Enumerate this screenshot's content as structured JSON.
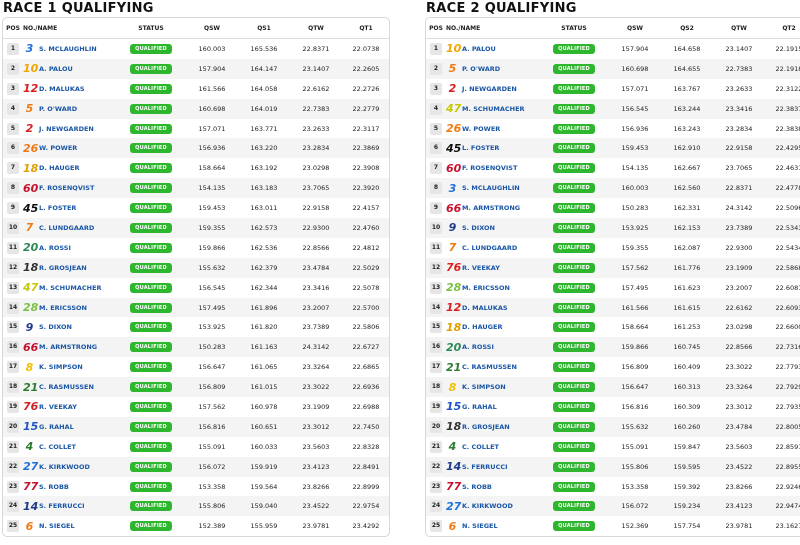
{
  "race1": {
    "title": "RACE 1 QUALIFYING",
    "headers": [
      "POS",
      "NO./NAME",
      "STATUS",
      "QSW",
      "QS1",
      "QTW",
      "QT1"
    ],
    "rows": [
      {
        "pos": "1",
        "num": "3",
        "color": "#1e6fd9",
        "name": "S. MCLAUGHLIN",
        "status": "QUALIFIED",
        "qsw": "160.003",
        "qs": "165.536",
        "qtw": "22.8371",
        "qt": "22.0738"
      },
      {
        "pos": "2",
        "num": "10",
        "color": "#f0a500",
        "name": "A. PALOU",
        "status": "QUALIFIED",
        "qsw": "157.904",
        "qs": "164.147",
        "qtw": "23.1407",
        "qt": "22.2605"
      },
      {
        "pos": "3",
        "num": "12",
        "color": "#d81e1e",
        "name": "D. MALUKAS",
        "status": "QUALIFIED",
        "qsw": "161.566",
        "qs": "164.058",
        "qtw": "22.6162",
        "qt": "22.2726"
      },
      {
        "pos": "4",
        "num": "5",
        "color": "#f07a10",
        "name": "P. O'WARD",
        "status": "QUALIFIED",
        "qsw": "160.698",
        "qs": "164.019",
        "qtw": "22.7383",
        "qt": "22.2779"
      },
      {
        "pos": "5",
        "num": "2",
        "color": "#d81e1e",
        "name": "J. NEWGARDEN",
        "status": "QUALIFIED",
        "qsw": "157.071",
        "qs": "163.771",
        "qtw": "23.2633",
        "qt": "22.3117"
      },
      {
        "pos": "6",
        "num": "26",
        "color": "#f07a10",
        "name": "W. POWER",
        "status": "QUALIFIED",
        "qsw": "156.936",
        "qs": "163.220",
        "qtw": "23.2834",
        "qt": "22.3869"
      },
      {
        "pos": "7",
        "num": "18",
        "color": "#e0a000",
        "name": "D. HAUGER",
        "status": "QUALIFIED",
        "qsw": "158.664",
        "qs": "163.192",
        "qtw": "23.0298",
        "qt": "22.3908"
      },
      {
        "pos": "8",
        "num": "60",
        "color": "#c8102e",
        "name": "F. ROSENQVIST",
        "status": "QUALIFIED",
        "qsw": "154.135",
        "qs": "163.183",
        "qtw": "23.7065",
        "qt": "22.3920"
      },
      {
        "pos": "9",
        "num": "45",
        "color": "#111111",
        "name": "L. FOSTER",
        "status": "QUALIFIED",
        "qsw": "159.453",
        "qs": "163.011",
        "qtw": "22.9158",
        "qt": "22.4157"
      },
      {
        "pos": "10",
        "num": "7",
        "color": "#f07a10",
        "name": "C. LUNDGAARD",
        "status": "QUALIFIED",
        "qsw": "159.355",
        "qs": "162.573",
        "qtw": "22.9300",
        "qt": "22.4760"
      },
      {
        "pos": "11",
        "num": "20",
        "color": "#2e8b57",
        "name": "A. ROSSI",
        "status": "QUALIFIED",
        "qsw": "159.866",
        "qs": "162.536",
        "qtw": "22.8566",
        "qt": "22.4812"
      },
      {
        "pos": "12",
        "num": "18",
        "color": "#333333",
        "name": "R. GROSJEAN",
        "status": "QUALIFIED",
        "qsw": "155.632",
        "qs": "162.379",
        "qtw": "23.4784",
        "qt": "22.5029"
      },
      {
        "pos": "13",
        "num": "47",
        "color": "#c8c800",
        "name": "M. SCHUMACHER",
        "status": "QUALIFIED",
        "qsw": "156.545",
        "qs": "162.344",
        "qtw": "23.3416",
        "qt": "22.5078"
      },
      {
        "pos": "14",
        "num": "28",
        "color": "#7ac142",
        "name": "M. ERICSSON",
        "status": "QUALIFIED",
        "qsw": "157.495",
        "qs": "161.896",
        "qtw": "23.2007",
        "qt": "22.5700"
      },
      {
        "pos": "15",
        "num": "9",
        "color": "#1e3a8a",
        "name": "S. DIXON",
        "status": "QUALIFIED",
        "qsw": "153.925",
        "qs": "161.820",
        "qtw": "23.7389",
        "qt": "22.5806"
      },
      {
        "pos": "16",
        "num": "66",
        "color": "#c8102e",
        "name": "M. ARMSTRONG",
        "status": "QUALIFIED",
        "qsw": "150.283",
        "qs": "161.163",
        "qtw": "24.3142",
        "qt": "22.6727"
      },
      {
        "pos": "17",
        "num": "8",
        "color": "#f0c000",
        "name": "K. SIMPSON",
        "status": "QUALIFIED",
        "qsw": "156.647",
        "qs": "161.065",
        "qtw": "23.3264",
        "qt": "22.6865"
      },
      {
        "pos": "18",
        "num": "21",
        "color": "#2e7d32",
        "name": "C. RASMUSSEN",
        "status": "QUALIFIED",
        "qsw": "156.809",
        "qs": "161.015",
        "qtw": "23.3022",
        "qt": "22.6936"
      },
      {
        "pos": "19",
        "num": "76",
        "color": "#d81e1e",
        "name": "R. VEEKAY",
        "status": "QUALIFIED",
        "qsw": "157.562",
        "qs": "160.978",
        "qtw": "23.1909",
        "qt": "22.6988"
      },
      {
        "pos": "20",
        "num": "15",
        "color": "#1e56c8",
        "name": "G. RAHAL",
        "status": "QUALIFIED",
        "qsw": "156.816",
        "qs": "160.651",
        "qtw": "23.3012",
        "qt": "22.7450"
      },
      {
        "pos": "21",
        "num": "4",
        "color": "#2e7d32",
        "name": "C. COLLET",
        "status": "QUALIFIED",
        "qsw": "155.091",
        "qs": "160.033",
        "qtw": "23.5603",
        "qt": "22.8328"
      },
      {
        "pos": "22",
        "num": "27",
        "color": "#1e6fd9",
        "name": "K. KIRKWOOD",
        "status": "QUALIFIED",
        "qsw": "156.072",
        "qs": "159.919",
        "qtw": "23.4123",
        "qt": "22.8491"
      },
      {
        "pos": "23",
        "num": "77",
        "color": "#c8102e",
        "name": "S. ROBB",
        "status": "QUALIFIED",
        "qsw": "153.358",
        "qs": "159.564",
        "qtw": "23.8266",
        "qt": "22.8999"
      },
      {
        "pos": "24",
        "num": "14",
        "color": "#1e3a8a",
        "name": "S. FERRUCCI",
        "status": "QUALIFIED",
        "qsw": "155.806",
        "qs": "159.040",
        "qtw": "23.4522",
        "qt": "22.9754"
      },
      {
        "pos": "25",
        "num": "6",
        "color": "#f07a10",
        "name": "N. SIEGEL",
        "status": "QUALIFIED",
        "qsw": "152.389",
        "qs": "155.959",
        "qtw": "23.9781",
        "qt": "23.4292"
      }
    ]
  },
  "race2": {
    "title": "RACE 2 QUALIFYING",
    "headers": [
      "POS",
      "NO./NAME",
      "STATUS",
      "QSW",
      "QS2",
      "QTW",
      "QT2"
    ],
    "rows": [
      {
        "pos": "1",
        "num": "10",
        "color": "#f0a500",
        "name": "A. PALOU",
        "status": "QUALIFIED",
        "qsw": "157.904",
        "qs": "164.658",
        "qtw": "23.1407",
        "qt": "22.1915"
      },
      {
        "pos": "2",
        "num": "5",
        "color": "#f07a10",
        "name": "P. O'WARD",
        "status": "QUALIFIED",
        "qsw": "160.698",
        "qs": "164.655",
        "qtw": "22.7383",
        "qt": "22.1918"
      },
      {
        "pos": "3",
        "num": "2",
        "color": "#d81e1e",
        "name": "J. NEWGARDEN",
        "status": "QUALIFIED",
        "qsw": "157.071",
        "qs": "163.767",
        "qtw": "23.2633",
        "qt": "22.3122"
      },
      {
        "pos": "4",
        "num": "47",
        "color": "#c8c800",
        "name": "M. SCHUMACHER",
        "status": "QUALIFIED",
        "qsw": "156.545",
        "qs": "163.244",
        "qtw": "23.3416",
        "qt": "22.3837"
      },
      {
        "pos": "5",
        "num": "26",
        "color": "#f07a10",
        "name": "W. POWER",
        "status": "QUALIFIED",
        "qsw": "156.936",
        "qs": "163.243",
        "qtw": "23.2834",
        "qt": "22.3838"
      },
      {
        "pos": "6",
        "num": "45",
        "color": "#111111",
        "name": "L. FOSTER",
        "status": "QUALIFIED",
        "qsw": "159.453",
        "qs": "162.910",
        "qtw": "22.9158",
        "qt": "22.4295"
      },
      {
        "pos": "7",
        "num": "60",
        "color": "#c8102e",
        "name": "F. ROSENQVIST",
        "status": "QUALIFIED",
        "qsw": "154.135",
        "qs": "162.667",
        "qtw": "23.7065",
        "qt": "22.4631"
      },
      {
        "pos": "8",
        "num": "3",
        "color": "#1e6fd9",
        "name": "S. MCLAUGHLIN",
        "status": "QUALIFIED",
        "qsw": "160.003",
        "qs": "162.560",
        "qtw": "22.8371",
        "qt": "22.4778"
      },
      {
        "pos": "9",
        "num": "66",
        "color": "#c8102e",
        "name": "M. ARMSTRONG",
        "status": "QUALIFIED",
        "qsw": "150.283",
        "qs": "162.331",
        "qtw": "24.3142",
        "qt": "22.5096"
      },
      {
        "pos": "10",
        "num": "9",
        "color": "#1e3a8a",
        "name": "S. DIXON",
        "status": "QUALIFIED",
        "qsw": "153.925",
        "qs": "162.153",
        "qtw": "23.7389",
        "qt": "22.5343"
      },
      {
        "pos": "11",
        "num": "7",
        "color": "#f07a10",
        "name": "C. LUNDGAARD",
        "status": "QUALIFIED",
        "qsw": "159.355",
        "qs": "162.087",
        "qtw": "22.9300",
        "qt": "22.5434"
      },
      {
        "pos": "12",
        "num": "76",
        "color": "#d81e1e",
        "name": "R. VEEKAY",
        "status": "QUALIFIED",
        "qsw": "157.562",
        "qs": "161.776",
        "qtw": "23.1909",
        "qt": "22.5868"
      },
      {
        "pos": "13",
        "num": "28",
        "color": "#7ac142",
        "name": "M. ERICSSON",
        "status": "QUALIFIED",
        "qsw": "157.495",
        "qs": "161.623",
        "qtw": "23.2007",
        "qt": "22.6081"
      },
      {
        "pos": "14",
        "num": "12",
        "color": "#d81e1e",
        "name": "D. MALUKAS",
        "status": "QUALIFIED",
        "qsw": "161.566",
        "qs": "161.615",
        "qtw": "22.6162",
        "qt": "22.6093"
      },
      {
        "pos": "15",
        "num": "18",
        "color": "#e0a000",
        "name": "D. HAUGER",
        "status": "QUALIFIED",
        "qsw": "158.664",
        "qs": "161.253",
        "qtw": "23.0298",
        "qt": "22.6600"
      },
      {
        "pos": "16",
        "num": "20",
        "color": "#2e8b57",
        "name": "A. ROSSI",
        "status": "QUALIFIED",
        "qsw": "159.866",
        "qs": "160.745",
        "qtw": "22.8566",
        "qt": "22.7316"
      },
      {
        "pos": "17",
        "num": "21",
        "color": "#2e7d32",
        "name": "C. RASMUSSEN",
        "status": "QUALIFIED",
        "qsw": "156.809",
        "qs": "160.409",
        "qtw": "23.3022",
        "qt": "22.7793"
      },
      {
        "pos": "18",
        "num": "8",
        "color": "#f0c000",
        "name": "K. SIMPSON",
        "status": "QUALIFIED",
        "qsw": "156.647",
        "qs": "160.313",
        "qtw": "23.3264",
        "qt": "22.7929"
      },
      {
        "pos": "19",
        "num": "15",
        "color": "#1e56c8",
        "name": "G. RAHAL",
        "status": "QUALIFIED",
        "qsw": "156.816",
        "qs": "160.309",
        "qtw": "23.3012",
        "qt": "22.7935"
      },
      {
        "pos": "20",
        "num": "18",
        "color": "#333333",
        "name": "R. GROSJEAN",
        "status": "QUALIFIED",
        "qsw": "155.632",
        "qs": "160.260",
        "qtw": "23.4784",
        "qt": "22.8005"
      },
      {
        "pos": "21",
        "num": "4",
        "color": "#2e7d32",
        "name": "C. COLLET",
        "status": "QUALIFIED",
        "qsw": "155.091",
        "qs": "159.847",
        "qtw": "23.5603",
        "qt": "22.8591"
      },
      {
        "pos": "22",
        "num": "14",
        "color": "#1e3a8a",
        "name": "S. FERRUCCI",
        "status": "QUALIFIED",
        "qsw": "155.806",
        "qs": "159.595",
        "qtw": "23.4522",
        "qt": "22.8955"
      },
      {
        "pos": "23",
        "num": "77",
        "color": "#c8102e",
        "name": "S. ROBB",
        "status": "QUALIFIED",
        "qsw": "153.358",
        "qs": "159.392",
        "qtw": "23.8266",
        "qt": "22.9246"
      },
      {
        "pos": "24",
        "num": "27",
        "color": "#1e6fd9",
        "name": "K. KIRKWOOD",
        "status": "QUALIFIED",
        "qsw": "156.072",
        "qs": "159.234",
        "qtw": "23.4123",
        "qt": "22.9474"
      },
      {
        "pos": "25",
        "num": "6",
        "color": "#f07a10",
        "name": "N. SIEGEL",
        "status": "QUALIFIED",
        "qsw": "152.369",
        "qs": "157.754",
        "qtw": "23.9781",
        "qt": "23.1627"
      }
    ]
  }
}
